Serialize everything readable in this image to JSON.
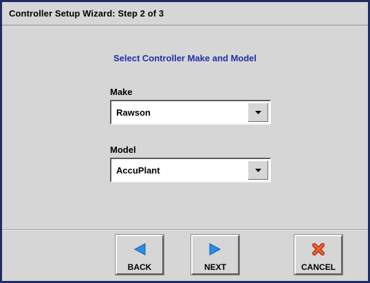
{
  "window": {
    "title": "Controller Setup Wizard:  Step 2 of 3"
  },
  "main": {
    "heading": "Select Controller Make and Model",
    "make": {
      "label": "Make",
      "value": "Rawson"
    },
    "model": {
      "label": "Model",
      "value": "AccuPlant"
    }
  },
  "footer": {
    "back_label": "BACK",
    "next_label": "NEXT",
    "cancel_label": "CANCEL"
  },
  "colors": {
    "background": "#d6d6d6",
    "heading_text": "#1f2fa8",
    "frame": "#1e2b66",
    "nav_arrow": "#2a8ee8",
    "cancel_icon": "#e8401c"
  },
  "icons": {
    "back": "arrow-left-icon",
    "next": "arrow-right-icon",
    "cancel": "close-x-icon",
    "dropdown": "chevron-down-icon"
  }
}
